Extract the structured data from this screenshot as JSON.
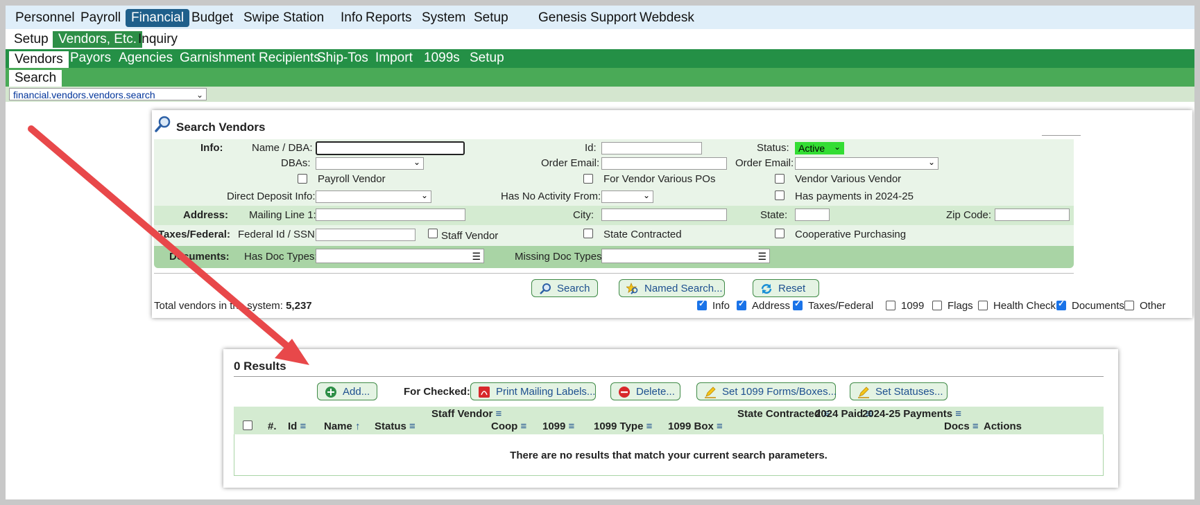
{
  "top_nav": [
    "Personnel",
    "Payroll",
    "Financial",
    "Budget",
    "Swipe Station",
    "Info",
    "Reports",
    "System",
    "Setup",
    "Genesis Support",
    "Webdesk"
  ],
  "sub_nav": [
    "Setup",
    "Vendors, Etc.",
    "Inquiry"
  ],
  "green_nav": [
    "Vendors",
    "Payors",
    "Agencies",
    "Garnishment Recipients",
    "Ship-Tos",
    "Import",
    "1099s",
    "Setup"
  ],
  "search_tab": "Search",
  "path_select": "financial.vendors.vendors.search",
  "panel": {
    "title": "Search Vendors",
    "info_label": "Info:",
    "name_dba_label": "Name / DBA:",
    "dbas_label": "DBAs:",
    "payroll_vendor": "Payroll Vendor",
    "direct_deposit_label": "Direct Deposit Info:",
    "id_label": "Id:",
    "order_email_label": "Order Email:",
    "for_vendor_various": "For Vendor Various POs",
    "has_no_activity_label": "Has No Activity From:",
    "status_label": "Status:",
    "status_value": "Active",
    "order_email_label2": "Order Email:",
    "vendor_various_vendor": "Vendor Various Vendor",
    "has_payments": "Has payments in 2024-25",
    "address_label": "Address:",
    "mailing_line_label": "Mailing Line 1:",
    "city_label": "City:",
    "state_label": "State:",
    "zip_label": "Zip Code:",
    "taxes_label": "Taxes/Federal:",
    "fed_id_label": "Federal Id / SSN:",
    "staff_vendor": "Staff Vendor",
    "state_contracted": "State Contracted",
    "coop_purchasing": "Cooperative Purchasing",
    "documents_label": "Documents:",
    "has_doc_types_label": "Has Doc Types:",
    "missing_doc_types_label": "Missing Doc Types:",
    "search_btn": "Search",
    "named_search_btn": "Named Search...",
    "reset_btn": "Reset",
    "total_label": "Total vendors in the system:",
    "total_value": "5,237",
    "filters": [
      {
        "label": "Info",
        "checked": true
      },
      {
        "label": "Address",
        "checked": true
      },
      {
        "label": "Taxes/Federal",
        "checked": true
      },
      {
        "label": "1099",
        "checked": false
      },
      {
        "label": "Flags",
        "checked": false
      },
      {
        "label": "Health Check",
        "checked": false
      },
      {
        "label": "Documents",
        "checked": true
      },
      {
        "label": "Other",
        "checked": false
      }
    ]
  },
  "results": {
    "title": "0 Results",
    "add_btn": "Add...",
    "for_checked": "For Checked:",
    "print_labels_btn": "Print Mailing Labels...",
    "delete_btn": "Delete...",
    "set_1099_btn": "Set 1099 Forms/Boxes...",
    "set_statuses_btn": "Set Statuses...",
    "columns": [
      "#.",
      "Id",
      "Name",
      "Status",
      "Staff Vendor",
      "Coop",
      "1099",
      "1099 Type",
      "1099 Box",
      "State Contracted",
      "2024 Paid",
      "2024-25 Payments",
      "Docs",
      "Actions"
    ],
    "empty_message": "There are no results that match your current search parameters."
  },
  "colors": {
    "accent_green": "#249046",
    "active_tab": "#1f5f8b",
    "status_green": "#33dd33",
    "arrow": "#e8484a"
  }
}
